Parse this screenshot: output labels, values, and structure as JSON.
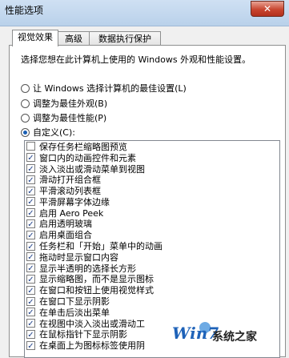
{
  "window": {
    "title": "性能选项",
    "close": "✕"
  },
  "tabs": [
    {
      "label": "视觉效果",
      "active": true
    },
    {
      "label": "高级",
      "active": false
    },
    {
      "label": "数据执行保护",
      "active": false
    }
  ],
  "description": "选择您想在此计算机上使用的 Windows 外观和性能设置。",
  "options": [
    {
      "label": "让 Windows 选择计算机的最佳设置(L)",
      "checked": false
    },
    {
      "label": "调整为最佳外观(B)",
      "checked": false
    },
    {
      "label": "调整为最佳性能(P)",
      "checked": false
    },
    {
      "label": "自定义(C):",
      "checked": true
    }
  ],
  "effects": [
    {
      "label": "保存任务栏缩略图预览",
      "checked": false
    },
    {
      "label": "窗口内的动画控件和元素",
      "checked": true
    },
    {
      "label": "淡入淡出或滑动菜单到视图",
      "checked": true
    },
    {
      "label": "滑动打开组合框",
      "checked": true
    },
    {
      "label": "平滑滚动列表框",
      "checked": true
    },
    {
      "label": "平滑屏幕字体边缘",
      "checked": true
    },
    {
      "label": "启用 Aero Peek",
      "checked": true
    },
    {
      "label": "启用透明玻璃",
      "checked": true
    },
    {
      "label": "启用桌面组合",
      "checked": true
    },
    {
      "label": "任务栏和「开始」菜单中的动画",
      "checked": true
    },
    {
      "label": "拖动时显示窗口内容",
      "checked": true
    },
    {
      "label": "显示半透明的选择长方形",
      "checked": true
    },
    {
      "label": "显示缩略图，而不是显示图标",
      "checked": true
    },
    {
      "label": "在窗口和按钮上使用视觉样式",
      "checked": true
    },
    {
      "label": "在窗口下显示阴影",
      "checked": true
    },
    {
      "label": "在单击后淡出菜单",
      "checked": true
    },
    {
      "label": "在视图中淡入淡出或滑动工",
      "checked": true
    },
    {
      "label": "在鼠标指针下显示阴影",
      "checked": true
    },
    {
      "label": "在桌面上为图标标签使用阴",
      "checked": true
    }
  ],
  "watermark": {
    "logo": "Win7",
    "site": "系统之家"
  }
}
